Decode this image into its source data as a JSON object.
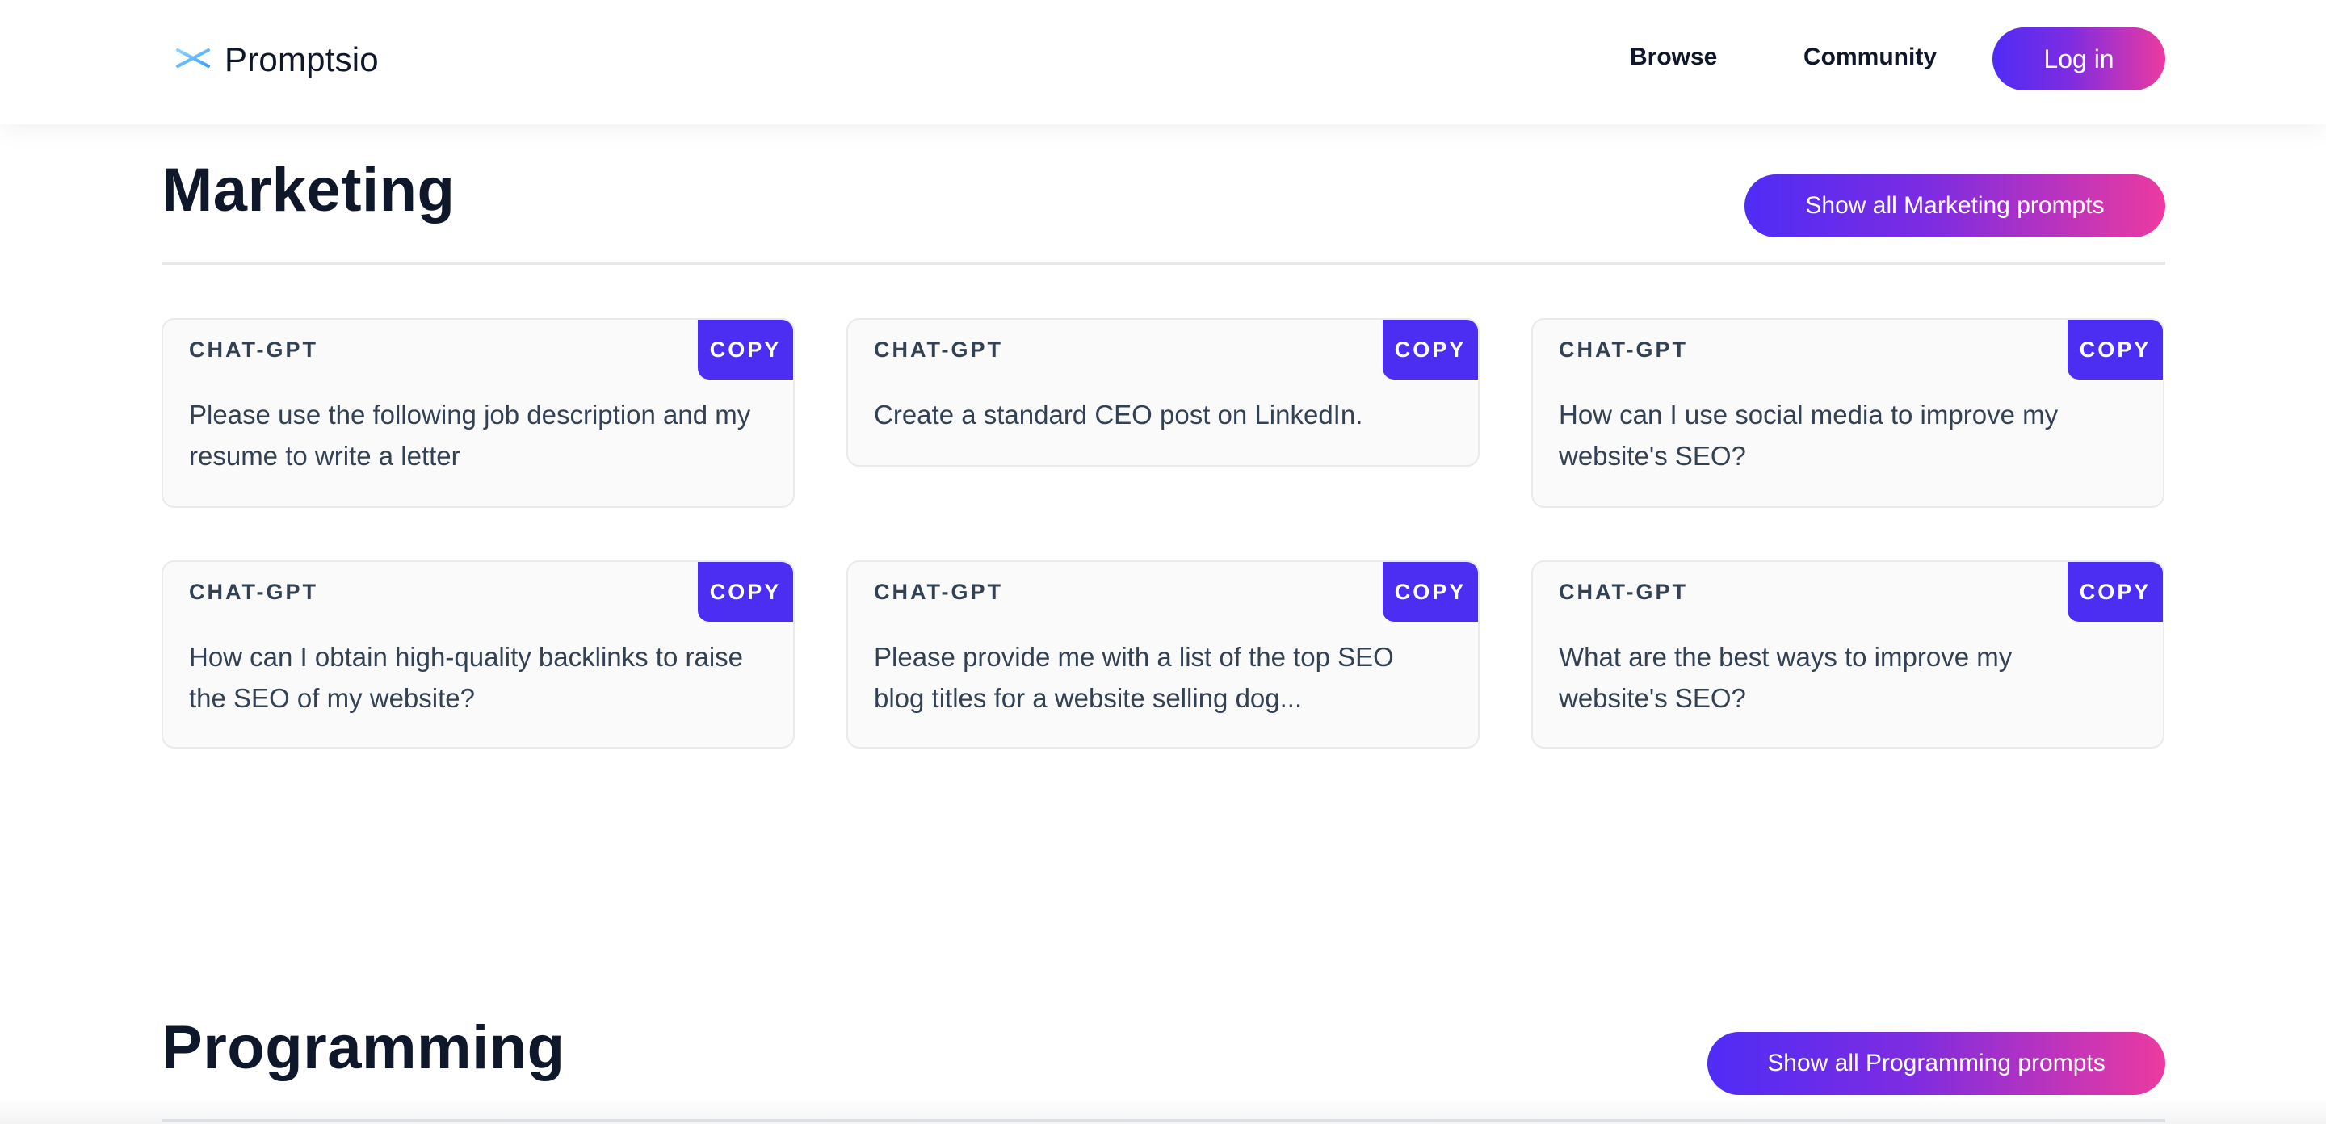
{
  "header": {
    "brand_name": "Promptsio",
    "nav": {
      "browse": "Browse",
      "community": "Community"
    },
    "login_label": "Log in"
  },
  "theme": {
    "accent": "#4b2ef2",
    "gradient_start": "#4f2cf5",
    "gradient_end": "#ec3aa0",
    "text_dark": "#0f172a",
    "text_body": "#334155"
  },
  "marketing": {
    "title": "Marketing",
    "show_all_label": "Show all Marketing prompts",
    "cards": [
      {
        "tag": "CHAT-GPT",
        "copy_label": "COPY",
        "text": "Please use the following job description and my resume to write a letter"
      },
      {
        "tag": "CHAT-GPT",
        "copy_label": "COPY",
        "text": "Create a standard CEO post on LinkedIn."
      },
      {
        "tag": "CHAT-GPT",
        "copy_label": "COPY",
        "text": "How can I use social media to improve my website's SEO?"
      },
      {
        "tag": "CHAT-GPT",
        "copy_label": "COPY",
        "text": "How can I obtain high-quality backlinks to raise the SEO of my website?"
      },
      {
        "tag": "CHAT-GPT",
        "copy_label": "COPY",
        "text": "Please provide me with a list of the top SEO blog titles for a website selling dog..."
      },
      {
        "tag": "CHAT-GPT",
        "copy_label": "COPY",
        "text": "What are the best ways to improve my website's SEO?"
      }
    ]
  },
  "programming": {
    "title": "Programming",
    "show_all_label": "Show all Programming prompts"
  }
}
